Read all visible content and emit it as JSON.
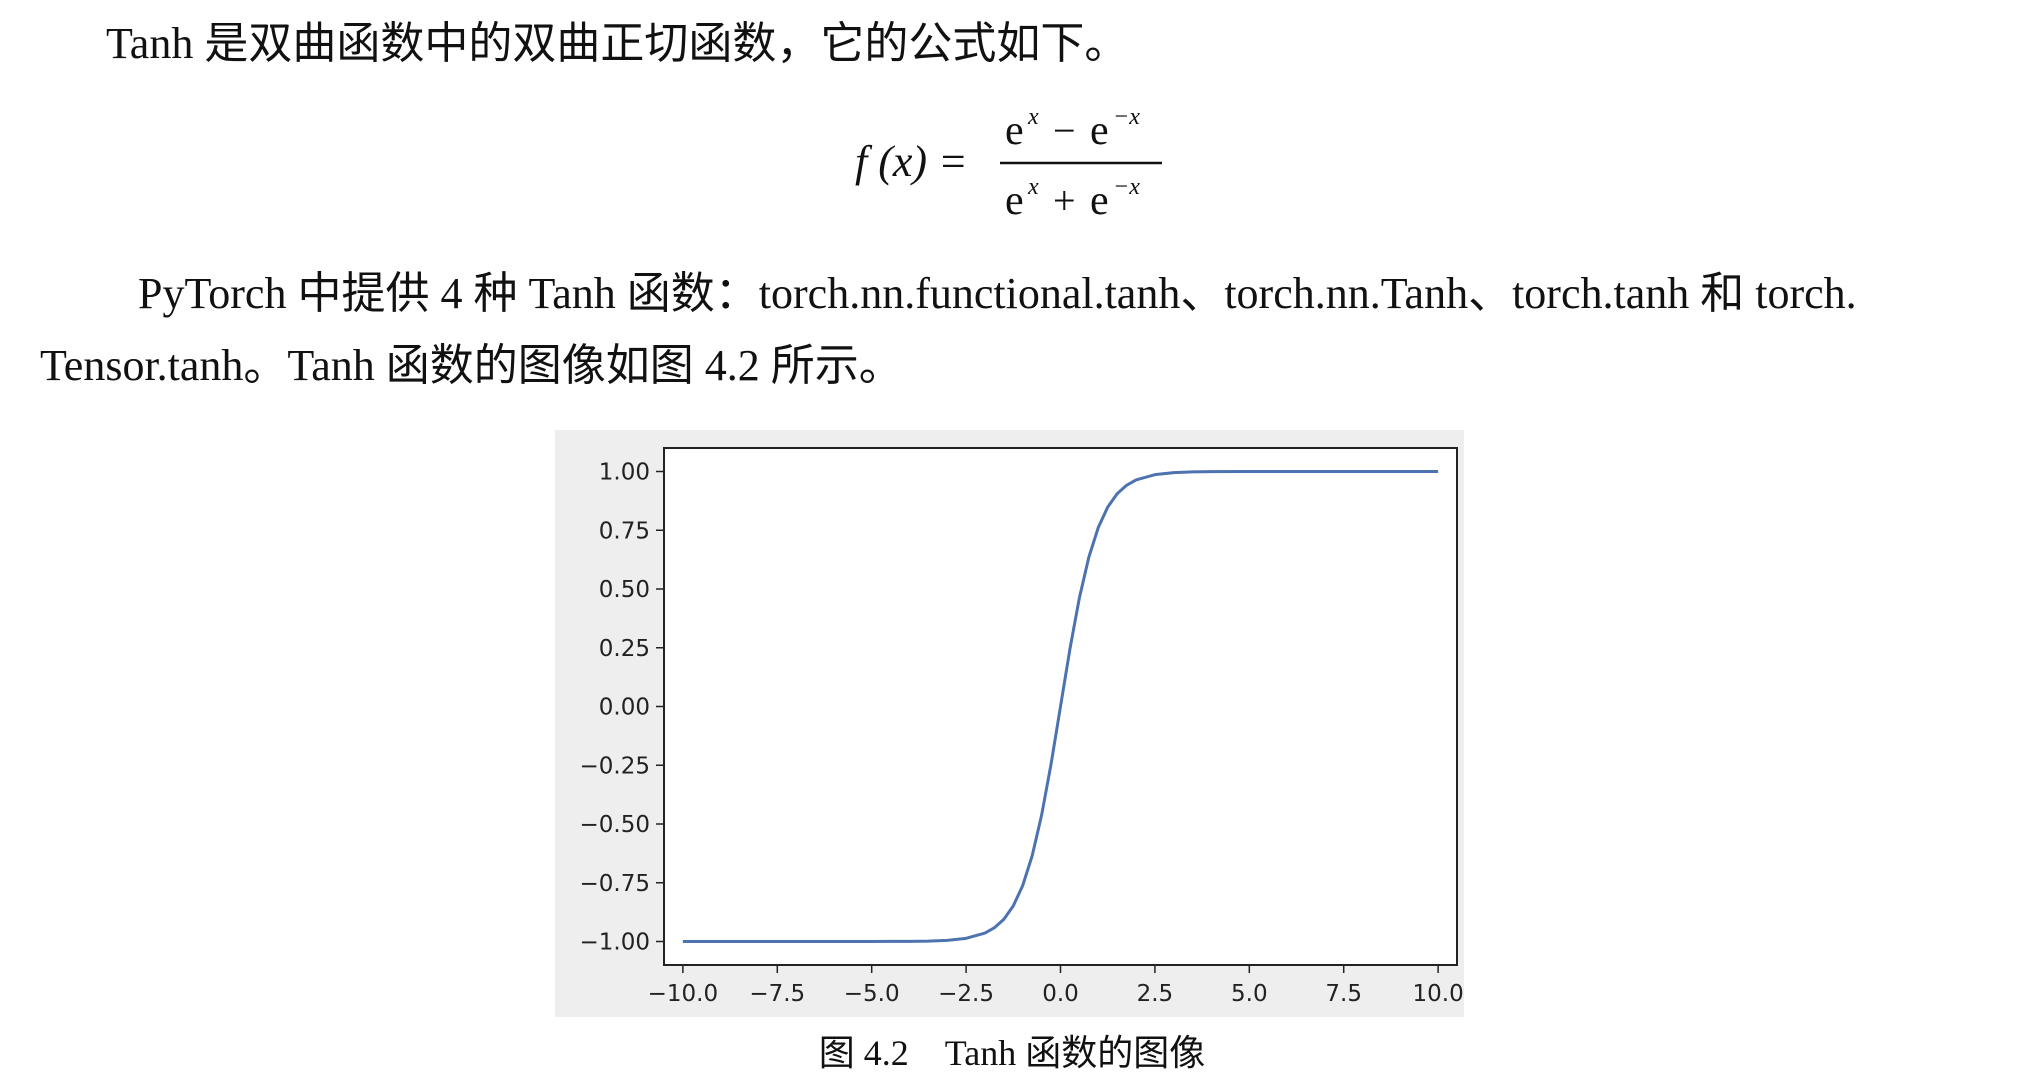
{
  "paragraphs": {
    "intro": "Tanh 是双曲函数中的双曲正切函数，它的公式如下。",
    "functions_line1": "PyTorch 中提供 4 种 Tanh 函数：torch.nn.functional.tanh、torch.nn.Tanh、torch.tanh 和 torch.",
    "functions_line2": "Tensor.tanh。Tanh 函数的图像如图 4.2 所示。"
  },
  "formula": {
    "lhs": "f (x) =",
    "numerator_a": "e",
    "numerator_a_exp": "x",
    "numerator_op": "−",
    "numerator_b": "e",
    "numerator_b_exp": "−x",
    "denominator_a": "e",
    "denominator_a_exp": "x",
    "denominator_op": "+",
    "denominator_b": "e",
    "denominator_b_exp": "−x"
  },
  "caption": "图 4.2    Tanh 函数的图像",
  "chart_data": {
    "type": "line",
    "title": "",
    "xlabel": "",
    "ylabel": "",
    "xlim": [
      -10.5,
      10.5
    ],
    "ylim": [
      -1.1,
      1.1
    ],
    "x_ticks": [
      -10.0,
      -7.5,
      -5.0,
      -2.5,
      0.0,
      2.5,
      5.0,
      7.5,
      10.0
    ],
    "x_tick_labels": [
      "−10.0",
      "−7.5",
      "−5.0",
      "−2.5",
      "0.0",
      "2.5",
      "5.0",
      "7.5",
      "10.0"
    ],
    "y_ticks": [
      1.0,
      0.75,
      0.5,
      0.25,
      0.0,
      -0.25,
      -0.5,
      -0.75,
      -1.0
    ],
    "y_tick_labels": [
      "1.00",
      "0.75",
      "0.50",
      "0.25",
      "0.00",
      "−0.25",
      "−0.50",
      "−0.75",
      "−1.00"
    ],
    "grid": false,
    "line_color": "#4c72b0",
    "series": [
      {
        "x": [
          -10.0,
          -9.0,
          -8.0,
          -7.0,
          -6.0,
          -5.0,
          -4.0,
          -3.5,
          -3.0,
          -2.5,
          -2.0,
          -1.75,
          -1.5,
          -1.25,
          -1.0,
          -0.75,
          -0.5,
          -0.25,
          0.0,
          0.25,
          0.5,
          0.75,
          1.0,
          1.25,
          1.5,
          1.75,
          2.0,
          2.5,
          3.0,
          3.5,
          4.0,
          5.0,
          6.0,
          7.0,
          8.0,
          9.0,
          10.0
        ],
        "y": [
          -1.0,
          -1.0,
          -1.0,
          -1.0,
          -1.0,
          -0.9999,
          -0.9993,
          -0.9982,
          -0.9951,
          -0.9866,
          -0.964,
          -0.9414,
          -0.9051,
          -0.8483,
          -0.7616,
          -0.6351,
          -0.4621,
          -0.2449,
          0.0,
          0.2449,
          0.4621,
          0.6351,
          0.7616,
          0.8483,
          0.9051,
          0.9414,
          0.964,
          0.9866,
          0.9951,
          0.9982,
          0.9993,
          0.9999,
          1.0,
          1.0,
          1.0,
          1.0,
          1.0
        ]
      }
    ]
  }
}
